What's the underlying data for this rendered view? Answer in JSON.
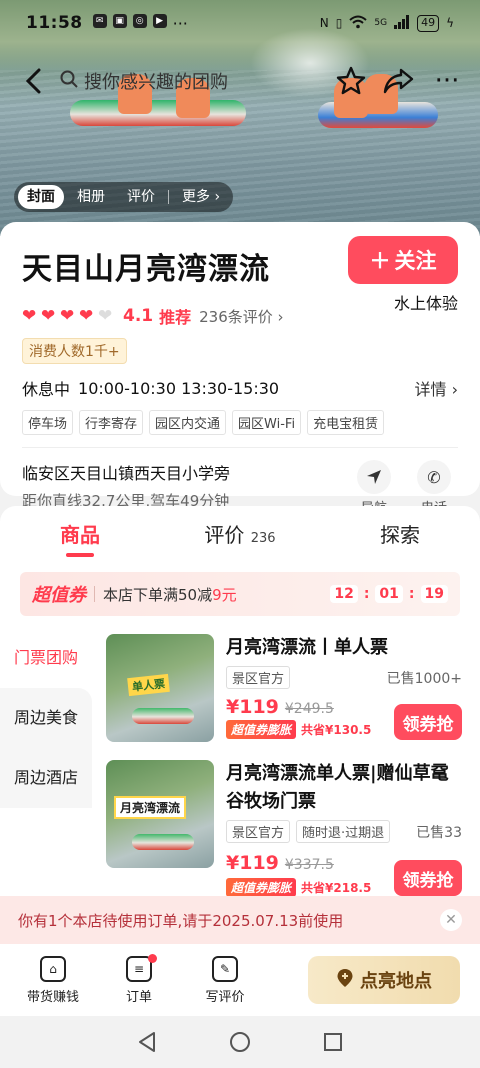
{
  "status": {
    "time": "11:58",
    "battery": "49",
    "network": "5G"
  },
  "search": {
    "placeholder": "搜你感兴趣的团购"
  },
  "media_tabs": [
    "封面",
    "相册",
    "评价",
    "更多 ›"
  ],
  "poi": {
    "title": "天目山月亮湾漂流",
    "follow_label": "关注",
    "score": "4.1",
    "recommend_label": "推荐",
    "reviews": "236条评价 ›",
    "category": "水上体验",
    "consume_badge": "消费人数1千+",
    "status": "休息中",
    "hours": "10:00-10:30 13:30-15:30",
    "hours_detail": "详情 ›",
    "facilities": [
      "停车场",
      "行李寄存",
      "园区内交通",
      "园区Wi-Fi",
      "充电宝租赁"
    ],
    "address": "临安区天目山镇西天目小学旁",
    "distance": "距你直线32.7公里,驾车49分钟",
    "nav_label": "导航",
    "phone_label": "电话"
  },
  "tabs": [
    {
      "label": "商品",
      "count": ""
    },
    {
      "label": "评价",
      "count": "236"
    },
    {
      "label": "探索",
      "count": ""
    }
  ],
  "coupon": {
    "brand": "超值券",
    "desc_prefix": "本店下单满50减",
    "amount": "9元",
    "timer": [
      "12",
      "01",
      "19"
    ]
  },
  "sidebar": [
    "门票团购",
    "周边美食",
    "周边酒店"
  ],
  "products": [
    {
      "name": "月亮湾漂流丨单人票",
      "tags": [
        "景区官方"
      ],
      "sold": "已售1000+",
      "price": "¥119",
      "original_price": "¥249.5",
      "deal_tag": "超值券膨胀",
      "save": "共省¥130.5",
      "button": "领券抢",
      "thumb_text": "单人票"
    },
    {
      "name": "月亮湾漂流单人票|赠仙草鼋谷牧场门票",
      "tags": [
        "景区官方",
        "随时退·过期退"
      ],
      "sold": "已售33",
      "price": "¥119",
      "original_price": "¥337.5",
      "deal_tag": "超值券膨胀",
      "save": "共省¥218.5",
      "button": "领券抢",
      "thumb_text": "月亮湾漂流"
    }
  ],
  "notice": "你有1个本店待使用订单,请于2025.07.13前使用",
  "bottom": {
    "promote": "带货赚钱",
    "orders": "订单",
    "review": "写评价",
    "light_up": "点亮地点"
  },
  "colors": {
    "accent": "#ff3b4d",
    "button": "#ff4c5e"
  }
}
